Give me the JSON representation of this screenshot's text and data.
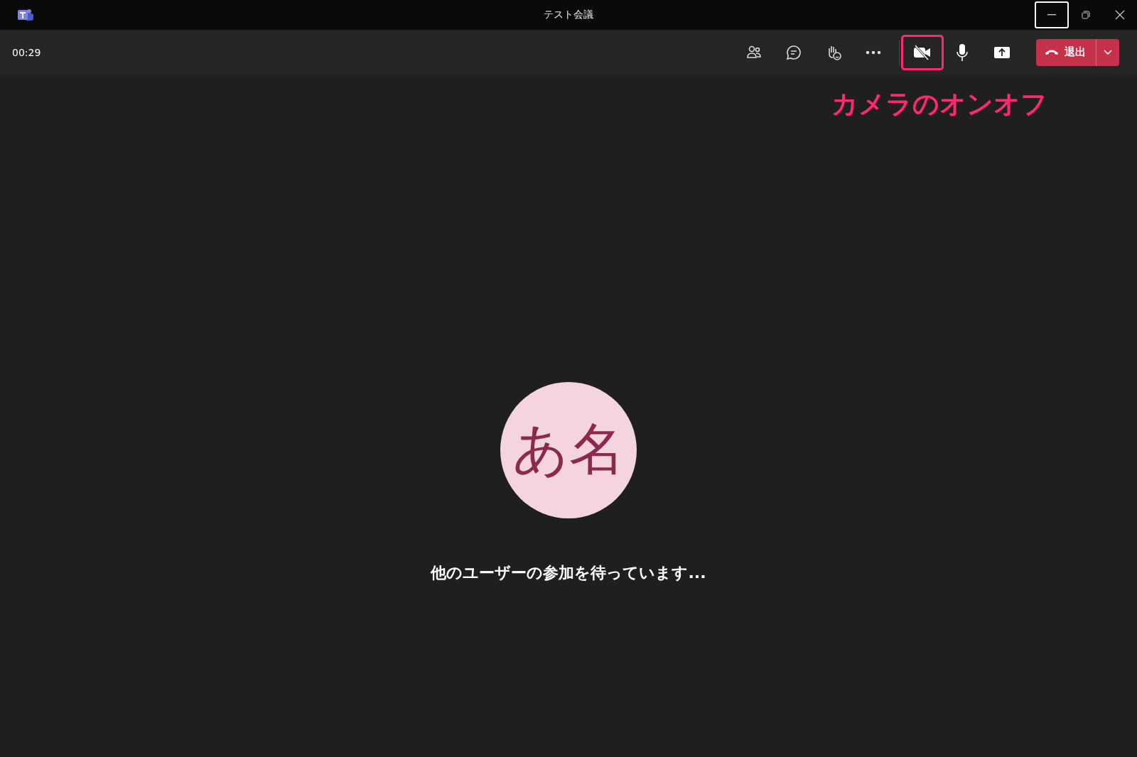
{
  "window": {
    "title": "テスト会議",
    "controls": [
      {
        "kind": "minimize",
        "focused": true
      },
      {
        "kind": "restore",
        "focused": false
      },
      {
        "kind": "close",
        "focused": false
      }
    ]
  },
  "toolbar": {
    "timer": "00:29",
    "buttons": [
      {
        "kind": "people",
        "highlighted": false
      },
      {
        "kind": "chat",
        "highlighted": false
      },
      {
        "kind": "react",
        "highlighted": false
      },
      {
        "kind": "more",
        "highlighted": false
      },
      {
        "kind": "camera-off",
        "highlighted": true
      },
      {
        "kind": "mic",
        "highlighted": false
      },
      {
        "kind": "share",
        "highlighted": false
      }
    ],
    "leave": {
      "label": "退出"
    }
  },
  "annotation": "カメラのオンオフ",
  "stage": {
    "avatar": {
      "initials": "あ名"
    },
    "message": "他のユーザーの参加を待っています..."
  }
}
